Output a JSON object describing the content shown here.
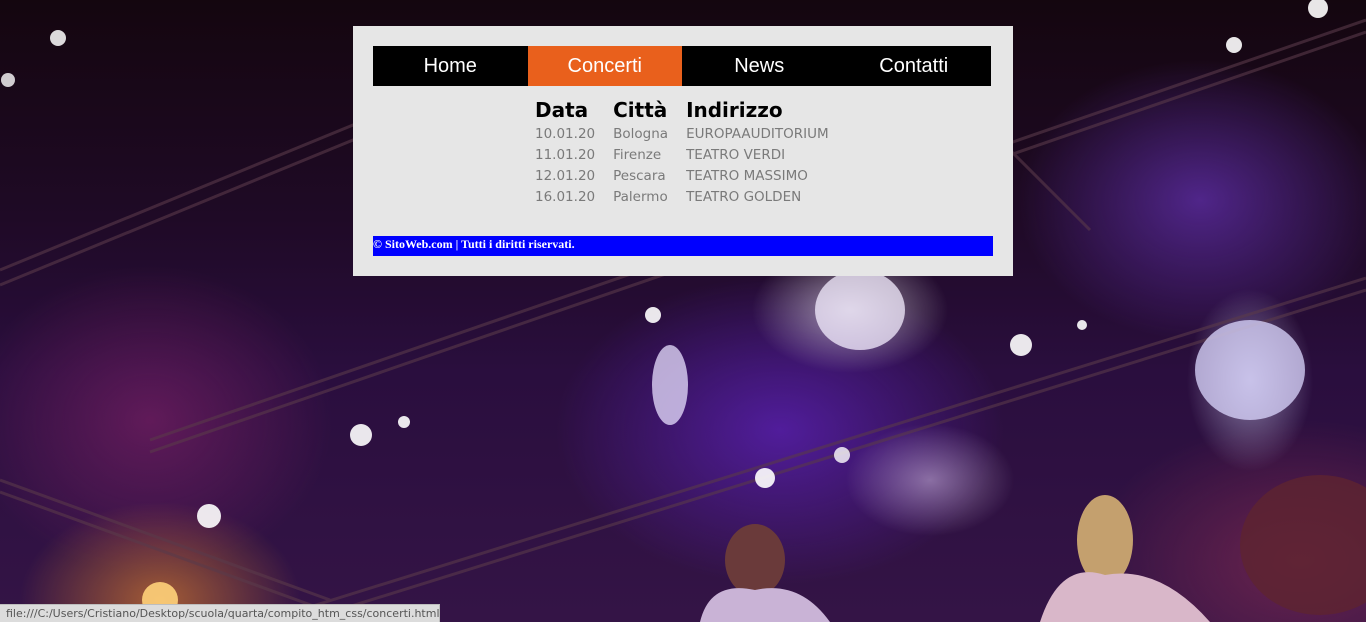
{
  "nav": {
    "items": [
      {
        "label": "Home",
        "active": false
      },
      {
        "label": "Concerti",
        "active": true
      },
      {
        "label": "News",
        "active": false
      },
      {
        "label": "Contatti",
        "active": false
      }
    ]
  },
  "table": {
    "headers": [
      "Data",
      "Città",
      "Indirizzo"
    ],
    "rows": [
      [
        "10.01.20",
        "Bologna",
        "EUROPAAUDITORIUM"
      ],
      [
        "11.01.20",
        "Firenze",
        "TEATRO VERDI"
      ],
      [
        "12.01.20",
        "Pescara",
        "TEATRO MASSIMO"
      ],
      [
        "16.01.20",
        "Palermo",
        "TEATRO GOLDEN"
      ]
    ]
  },
  "footer": {
    "text": "© SitoWeb.com | Tutti i diritti riservati."
  },
  "statusbar": {
    "url": "file:///C:/Users/Cristiano/Desktop/scuola/quarta/compito_htm_css/concerti.html"
  },
  "colors": {
    "nav_bg": "#000000",
    "nav_active": "#e9601c",
    "footer_bg": "#0000ff",
    "panel_bg": "#e6e6e6"
  }
}
